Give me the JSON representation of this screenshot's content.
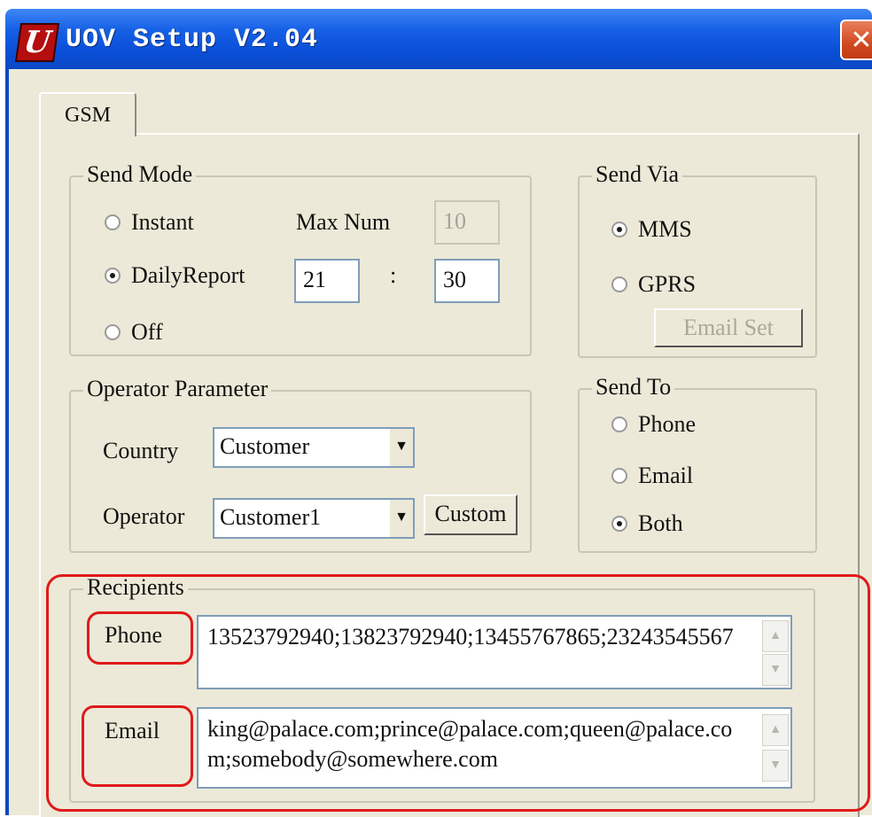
{
  "window": {
    "title": "UOV Setup V2.04",
    "app_icon_letter": "U",
    "close_glyph": "✕"
  },
  "tabs": [
    {
      "label": "GSM",
      "selected": true
    }
  ],
  "send_mode": {
    "legend": "Send Mode",
    "options": [
      {
        "label": "Instant",
        "selected": false
      },
      {
        "label": "DailyReport",
        "selected": true
      },
      {
        "label": "Off",
        "selected": false
      }
    ],
    "max_num_label": "Max Num",
    "max_num_value": "10",
    "hour": "21",
    "separator": ":",
    "minute": "30"
  },
  "send_via": {
    "legend": "Send Via",
    "options": [
      {
        "label": "MMS",
        "selected": true
      },
      {
        "label": "GPRS",
        "selected": false
      }
    ],
    "email_set_label": "Email Set"
  },
  "operator_parameter": {
    "legend": "Operator Parameter",
    "country_label": "Country",
    "country_value": "Customer",
    "operator_label": "Operator",
    "operator_value": "Customer1",
    "custom_label": "Custom",
    "dropdown_glyph": "▼"
  },
  "send_to": {
    "legend": "Send To",
    "options": [
      {
        "label": "Phone",
        "selected": false
      },
      {
        "label": "Email",
        "selected": false
      },
      {
        "label": "Both",
        "selected": true
      }
    ]
  },
  "recipients": {
    "legend": "Recipients",
    "phone_label": "Phone",
    "phone_value": "13523792940;13823792940;13455767865;23243545567",
    "email_label": "Email",
    "email_value": "king@palace.com;prince@palace.com;queen@palace.com;somebody@somewhere.com",
    "scroll_up_glyph": "▲",
    "scroll_down_glyph": "▼"
  },
  "colors": {
    "title_bar": "#0b48c4",
    "dialog_bg": "#ece9d8",
    "highlight": "#e01a1a",
    "close_button": "#d1491f"
  }
}
